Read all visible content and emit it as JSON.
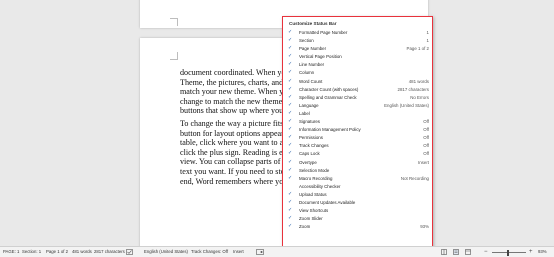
{
  "document": {
    "paragraph1": [
      "document coordinated. When you cli",
      "Theme, the pictures, charts, and Sm",
      "match your new theme. When you a",
      "change to match the new theme. Sav",
      "buttons that show up where you nee"
    ],
    "paragraph2": [
      "To change the way a picture fits in y",
      "button for layout options appears nex",
      "table, click where you want to add a",
      "click the plus sign. Reading is easie",
      "view. You can collapse parts of the",
      "text you want. If you need to stop re",
      "end, Word remembers where you left"
    ]
  },
  "menu": {
    "title": "Customize Status Bar",
    "items": [
      {
        "checked": true,
        "label": "Formatted Page Number",
        "value": "1"
      },
      {
        "checked": true,
        "label": "Section",
        "value": "1"
      },
      {
        "checked": true,
        "label": "Page Number",
        "value": "Page 1 of 2"
      },
      {
        "checked": true,
        "label": "Vertical Page Position",
        "value": ""
      },
      {
        "checked": true,
        "label": "Line Number",
        "value": ""
      },
      {
        "checked": true,
        "label": "Column",
        "value": ""
      },
      {
        "checked": true,
        "label": "Word Count",
        "value": "481 words"
      },
      {
        "checked": true,
        "label": "Character Count (with spaces)",
        "value": "2817 characters"
      },
      {
        "checked": true,
        "label": "Spelling and Grammar Check",
        "value": "No Errors"
      },
      {
        "checked": true,
        "label": "Language",
        "value": "English (United States)"
      },
      {
        "checked": true,
        "label": "Label",
        "value": ""
      },
      {
        "checked": true,
        "label": "Signatures",
        "value": "Off"
      },
      {
        "checked": true,
        "label": "Information Management Policy",
        "value": "Off"
      },
      {
        "checked": true,
        "label": "Permissions",
        "value": "Off"
      },
      {
        "checked": true,
        "label": "Track Changes",
        "value": "Off"
      },
      {
        "checked": true,
        "label": "Caps Lock",
        "value": "Off"
      },
      {
        "checked": true,
        "label": "Overtype",
        "value": "Insert"
      },
      {
        "checked": true,
        "label": "Selection Mode",
        "value": ""
      },
      {
        "checked": true,
        "label": "Macro Recording",
        "value": "Not Recording"
      },
      {
        "checked": false,
        "label": "Accessibility Checker",
        "value": ""
      },
      {
        "checked": true,
        "label": "Upload Status",
        "value": ""
      },
      {
        "checked": true,
        "label": "Document Updates Available",
        "value": ""
      },
      {
        "checked": true,
        "label": "View Shortcuts",
        "value": ""
      },
      {
        "checked": true,
        "label": "Zoom Slider",
        "value": ""
      },
      {
        "checked": true,
        "label": "Zoom",
        "value": "93%"
      }
    ],
    "check_glyph": "✓",
    "accent_color": "#e8323c"
  },
  "statusbar": {
    "page": "PAGE: 1",
    "section": "Section: 1",
    "page_of": "Page 1 of 2",
    "words": "481 words",
    "characters": "2817 characters",
    "language": "English (United States)",
    "track_changes": "Track Changes: Off",
    "insert": "Insert",
    "zoom_minus": "−",
    "zoom_plus": "+",
    "zoom": "93%",
    "zoom_level": 0.93
  }
}
